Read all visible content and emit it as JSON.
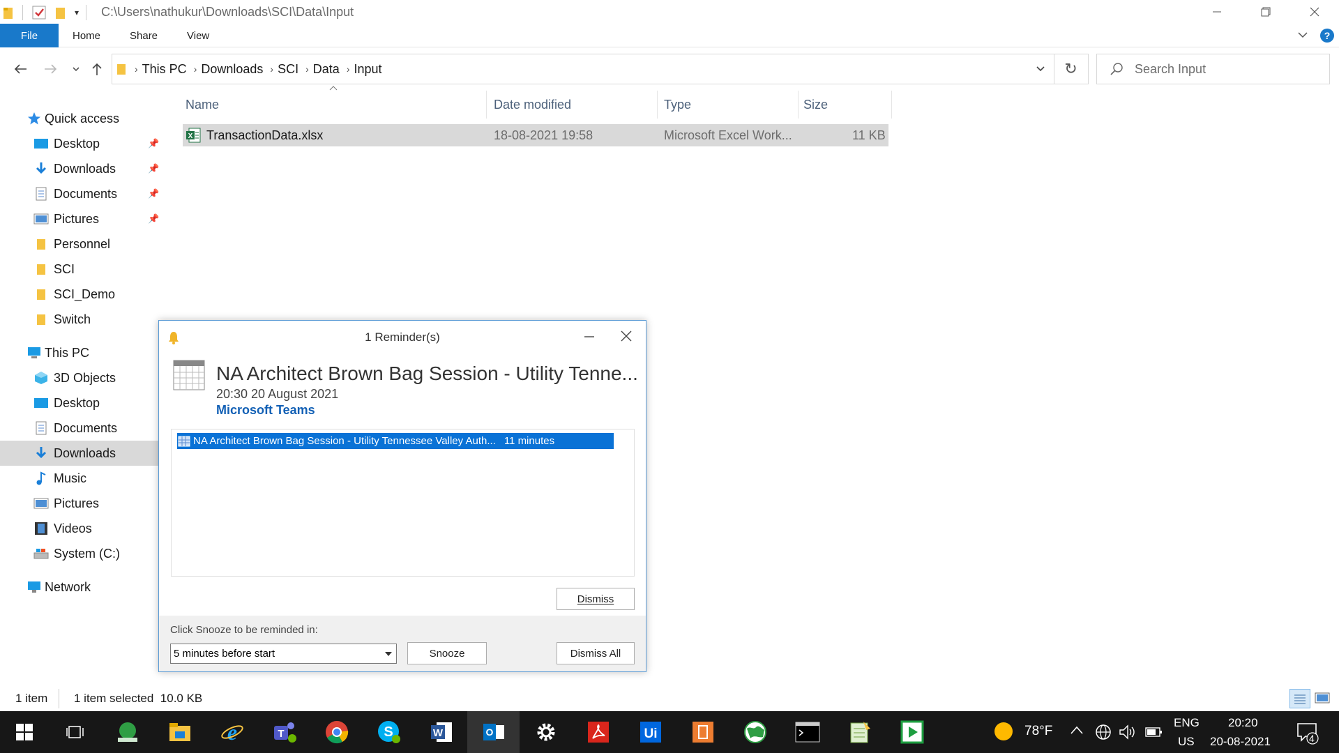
{
  "window": {
    "path": "C:\\Users\\nathukur\\Downloads\\SCI\\Data\\Input"
  },
  "ribbon": {
    "tabs": [
      "File",
      "Home",
      "Share",
      "View"
    ]
  },
  "address": {
    "crumbs": [
      "This PC",
      "Downloads",
      "SCI",
      "Data",
      "Input"
    ]
  },
  "search": {
    "placeholder": "Search Input"
  },
  "nav": {
    "quick_access": "Quick access",
    "quick_items": [
      "Desktop",
      "Downloads",
      "Documents",
      "Pictures",
      "Personnel",
      "SCI",
      "SCI_Demo",
      "Switch"
    ],
    "this_pc": "This PC",
    "pc_items": [
      "3D Objects",
      "Desktop",
      "Documents",
      "Downloads",
      "Music",
      "Pictures",
      "Videos",
      "System (C:)"
    ],
    "network": "Network"
  },
  "files": {
    "headers": [
      "Name",
      "Date modified",
      "Type",
      "Size"
    ],
    "rows": [
      {
        "name": "TransactionData.xlsx",
        "date": "18-08-2021 19:58",
        "type": "Microsoft Excel Work...",
        "size": "11 KB"
      }
    ]
  },
  "status": {
    "count": "1 item",
    "selected": "1 item selected  10.0 KB"
  },
  "reminder": {
    "title": "1 Reminder(s)",
    "subject": "NA Architect Brown Bag Session - Utility Tenne...",
    "when": "20:30 20 August 2021",
    "location": "Microsoft Teams",
    "item_subject": "NA Architect Brown Bag Session - Utility Tennessee Valley Auth...",
    "item_due": "11 minutes",
    "dismiss": "Dismiss",
    "snooze_prompt": "Click Snooze to be reminded in:",
    "snooze_value": "5 minutes before start",
    "snooze": "Snooze",
    "dismiss_all": "Dismiss All"
  },
  "tray": {
    "weather": "78°F",
    "lang": "ENG",
    "region": "US",
    "time": "20:20",
    "date": "20-08-2021",
    "notifications": "4"
  },
  "colors": {
    "accent": "#1979ca",
    "selection": "#0a72d6",
    "taskbar": "#171717"
  }
}
